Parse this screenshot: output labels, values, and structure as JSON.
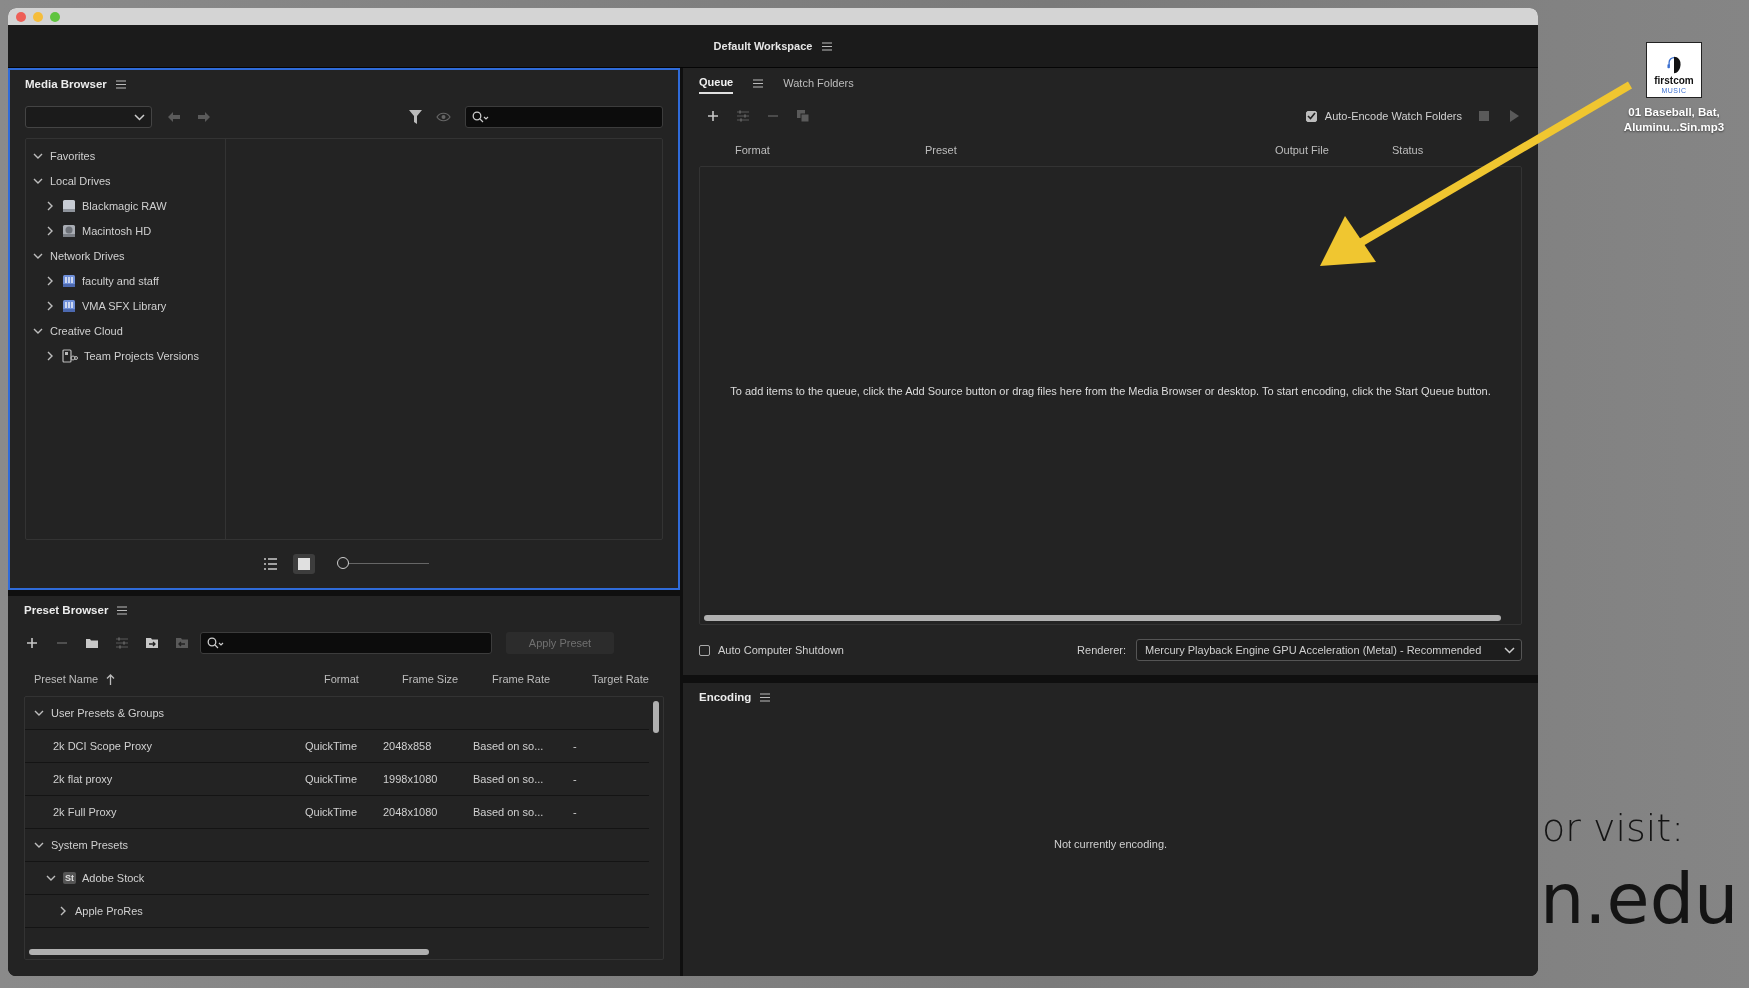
{
  "window": {
    "title": "Default Workspace"
  },
  "media_browser": {
    "title": "Media Browser",
    "nav": [
      {
        "kind": "back",
        "disabled": true
      },
      {
        "kind": "forward",
        "disabled": true
      }
    ],
    "tree": [
      {
        "label": "Favorites",
        "expanded": true
      },
      {
        "label": "Local Drives",
        "expanded": true,
        "children": [
          {
            "label": "Blackmagic RAW",
            "kind": "drive",
            "expanded": false
          },
          {
            "label": "Macintosh HD",
            "kind": "disk",
            "expanded": false
          }
        ]
      },
      {
        "label": "Network Drives",
        "expanded": true,
        "children": [
          {
            "label": "faculty and staff",
            "kind": "network",
            "expanded": false
          },
          {
            "label": "VMA SFX Library",
            "kind": "network",
            "expanded": false
          }
        ]
      },
      {
        "label": "Creative Cloud",
        "expanded": true,
        "children": [
          {
            "label": "Team Projects Versions",
            "kind": "team",
            "expanded": false
          }
        ]
      }
    ],
    "view_modes": [
      {
        "kind": "list",
        "selected": false
      },
      {
        "kind": "thumbnail",
        "selected": true
      }
    ],
    "zoom_slider": {
      "level": 0
    }
  },
  "preset_browser": {
    "title": "Preset Browser",
    "toolbar": [
      {
        "kind": "add",
        "disabled": false
      },
      {
        "kind": "remove",
        "disabled": true
      },
      {
        "kind": "folder",
        "disabled": false
      },
      {
        "kind": "settings",
        "disabled": true
      },
      {
        "kind": "import",
        "disabled": false
      },
      {
        "kind": "export",
        "disabled": true
      }
    ],
    "apply_button": {
      "label": "Apply Preset",
      "disabled": true
    },
    "columns": [
      {
        "label": "Preset Name",
        "sorted": true
      },
      {
        "label": "Format"
      },
      {
        "label": "Frame Size"
      },
      {
        "label": "Frame Rate"
      },
      {
        "label": "Target Rate"
      }
    ],
    "rows": [
      {
        "kind": "group",
        "label": "User Presets & Groups",
        "expanded": true,
        "children": [
          {
            "kind": "preset",
            "name": "2k DCI Scope Proxy",
            "format": "QuickTime",
            "frame_size": "2048x858",
            "frame_rate": "Based on so...",
            "target_rate": "-"
          },
          {
            "kind": "preset",
            "name": "2k flat proxy",
            "format": "QuickTime",
            "frame_size": "1998x1080",
            "frame_rate": "Based on so...",
            "target_rate": "-"
          },
          {
            "kind": "preset",
            "name": "2k Full Proxy",
            "format": "QuickTime",
            "frame_size": "2048x1080",
            "frame_rate": "Based on so...",
            "target_rate": "-"
          }
        ]
      },
      {
        "kind": "group",
        "label": "System Presets",
        "expanded": true,
        "children": [
          {
            "kind": "group",
            "label": "Adobe Stock",
            "badge": "St",
            "expanded": true,
            "children": [
              {
                "kind": "group",
                "label": "Apple ProRes",
                "expanded": false
              }
            ]
          }
        ]
      }
    ]
  },
  "queue": {
    "tabs": [
      {
        "label": "Queue",
        "selected": true
      },
      {
        "label": "Watch Folders",
        "selected": false
      }
    ],
    "toolbar": [
      {
        "kind": "add",
        "disabled": false
      },
      {
        "kind": "settings",
        "disabled": true
      },
      {
        "kind": "remove",
        "disabled": true
      },
      {
        "kind": "duplicate",
        "disabled": true
      }
    ],
    "auto_encode": {
      "label": "Auto-Encode Watch Folders",
      "checked": true
    },
    "transport": [
      {
        "kind": "stop",
        "disabled": true
      },
      {
        "kind": "play",
        "disabled": true
      }
    ],
    "columns": [
      "Format",
      "Preset",
      "Output File",
      "Status"
    ],
    "empty_message": "To add items to the queue, click the Add Source button or drag files here from the Media Browser or desktop.  To start encoding, click the Start Queue button.",
    "auto_shutdown": {
      "label": "Auto Computer Shutdown",
      "checked": false
    },
    "renderer": {
      "label": "Renderer:",
      "value": "Mercury Playback Engine GPU Acceleration (Metal) - Recommended"
    }
  },
  "encoding": {
    "title": "Encoding",
    "message": "Not currently encoding."
  },
  "desktop": {
    "file": {
      "logo_text": "firstcom",
      "logo_subtext": "MUSIC",
      "name_lines": [
        "01 Baseball, Bat,",
        "Aluminu...Sin.mp3"
      ]
    },
    "background_text": [
      "or visit:",
      "n.edu"
    ]
  }
}
